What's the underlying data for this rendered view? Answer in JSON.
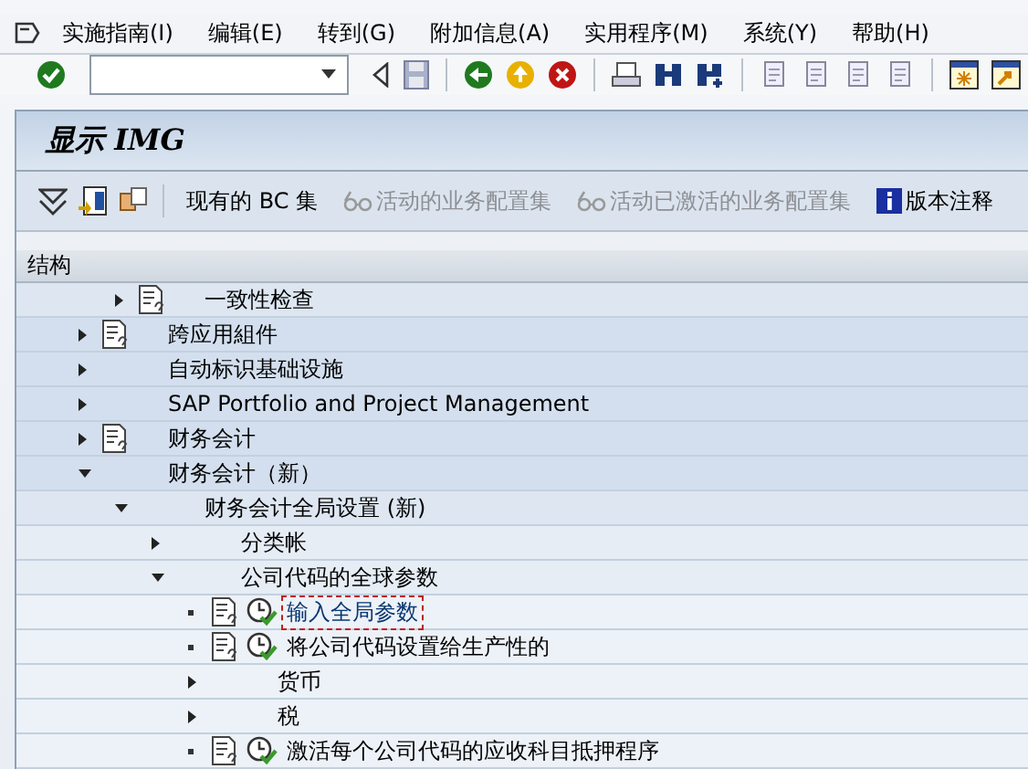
{
  "menu_bar": {
    "items": [
      {
        "label": "实施指南(I)"
      },
      {
        "label": "编辑(E)"
      },
      {
        "label": "转到(G)"
      },
      {
        "label": "附加信息(A)"
      },
      {
        "label": "实用程序(M)"
      },
      {
        "label": "系统(Y)"
      },
      {
        "label": "帮助(H)"
      }
    ]
  },
  "title": "显示 IMG",
  "app_toolbar": [
    {
      "kind": "icon"
    },
    {
      "kind": "icon"
    },
    {
      "kind": "icon"
    },
    {
      "kind": "text",
      "label": "现有的 BC 集",
      "disabled": false
    },
    {
      "kind": "glasses",
      "label": "活动的业务配置集",
      "disabled": true
    },
    {
      "kind": "glasses",
      "label": "活动已激活的业务配置集",
      "disabled": true
    },
    {
      "kind": "info",
      "label": "版本注释",
      "disabled": false
    }
  ],
  "tree": {
    "header": "结构",
    "continued_items": [
      {
        "label": "一致性检查",
        "kind": "node",
        "expanded": false,
        "doc": true,
        "selected": false
      }
    ],
    "items": [
      {
        "label": "跨应用組件",
        "kind": "node",
        "expanded": false,
        "doc": true,
        "selected": false
      },
      {
        "label": "自动标识基础设施",
        "kind": "node",
        "expanded": false,
        "doc": false,
        "selected": false
      },
      {
        "label": "SAP Portfolio and Project Management",
        "kind": "node",
        "expanded": false,
        "doc": false,
        "selected": false
      },
      {
        "label": "财务会计",
        "kind": "node",
        "expanded": false,
        "doc": true,
        "selected": false
      },
      {
        "label": "财务会计（新）",
        "kind": "node",
        "expanded": true,
        "doc": false,
        "selected": false,
        "children": [
          {
            "label": "财务会计全局设置 (新)",
            "kind": "node",
            "expanded": true,
            "doc": false,
            "selected": false,
            "children": [
              {
                "label": "分类帐",
                "kind": "node",
                "expanded": false,
                "doc": false,
                "selected": false
              },
              {
                "label": "公司代码的全球参数",
                "kind": "node",
                "expanded": true,
                "doc": false,
                "selected": false,
                "children": [
                  {
                    "label": "输入全局参数",
                    "kind": "activity",
                    "doc": true,
                    "selected": true
                  },
                  {
                    "label": "将公司代码设置给生产性的",
                    "kind": "activity",
                    "doc": true,
                    "selected": false
                  },
                  {
                    "label": "货币",
                    "kind": "node",
                    "expanded": false,
                    "doc": false,
                    "selected": false
                  },
                  {
                    "label": "税",
                    "kind": "node",
                    "expanded": false,
                    "doc": false,
                    "selected": false
                  },
                  {
                    "label": "激活每个公司代码的应收科目抵押程序",
                    "kind": "activity",
                    "doc": true,
                    "selected": false
                  }
                ]
              }
            ]
          }
        ]
      }
    ]
  }
}
